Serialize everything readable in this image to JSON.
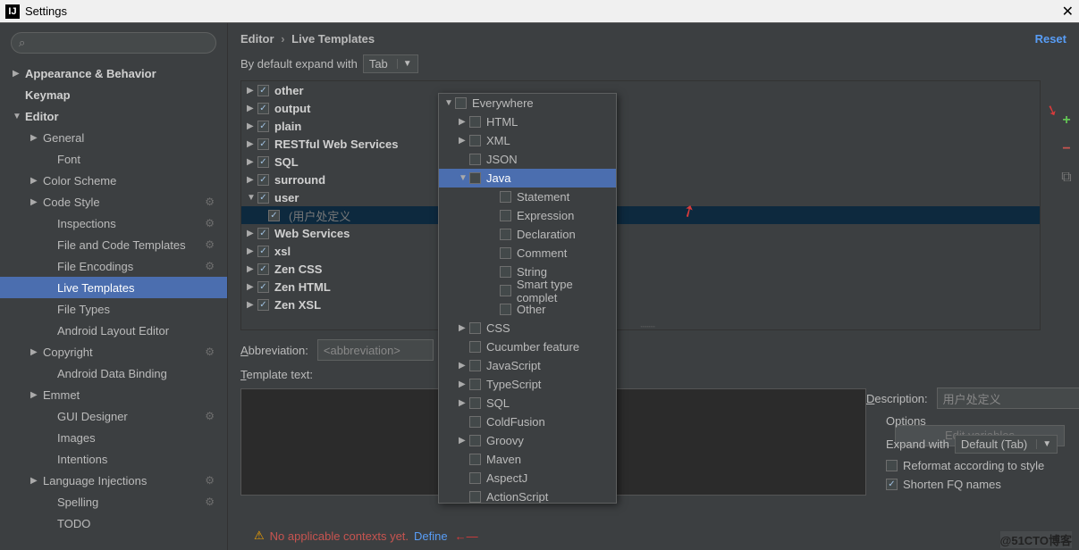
{
  "window": {
    "title": "Settings"
  },
  "header": {
    "breadcrumb_root": "Editor",
    "breadcrumb_leaf": "Live Templates",
    "reset": "Reset"
  },
  "expand": {
    "label": "By default expand with",
    "value": "Tab"
  },
  "sidebar": {
    "items": [
      {
        "label": "Appearance & Behavior",
        "lvl": 0,
        "arrow": "▶",
        "bold": true
      },
      {
        "label": "Keymap",
        "lvl": 0,
        "bold": true
      },
      {
        "label": "Editor",
        "lvl": 0,
        "arrow": "▼",
        "bold": true
      },
      {
        "label": "General",
        "lvl": 1,
        "arrow": "▶"
      },
      {
        "label": "Font",
        "lvl": 2
      },
      {
        "label": "Color Scheme",
        "lvl": 1,
        "arrow": "▶"
      },
      {
        "label": "Code Style",
        "lvl": 1,
        "arrow": "▶",
        "cog": true
      },
      {
        "label": "Inspections",
        "lvl": 2,
        "cog": true
      },
      {
        "label": "File and Code Templates",
        "lvl": 2,
        "cog": true
      },
      {
        "label": "File Encodings",
        "lvl": 2,
        "cog": true
      },
      {
        "label": "Live Templates",
        "lvl": 2,
        "selected": true
      },
      {
        "label": "File Types",
        "lvl": 2
      },
      {
        "label": "Android Layout Editor",
        "lvl": 2
      },
      {
        "label": "Copyright",
        "lvl": 1,
        "arrow": "▶",
        "cog": true
      },
      {
        "label": "Android Data Binding",
        "lvl": 2
      },
      {
        "label": "Emmet",
        "lvl": 1,
        "arrow": "▶"
      },
      {
        "label": "GUI Designer",
        "lvl": 2,
        "cog": true
      },
      {
        "label": "Images",
        "lvl": 2
      },
      {
        "label": "Intentions",
        "lvl": 2
      },
      {
        "label": "Language Injections",
        "lvl": 1,
        "arrow": "▶",
        "cog": true
      },
      {
        "label": "Spelling",
        "lvl": 2,
        "cog": true
      },
      {
        "label": "TODO",
        "lvl": 2
      }
    ]
  },
  "templates": {
    "groups": [
      {
        "name": "other",
        "checked": true
      },
      {
        "name": "output",
        "checked": true
      },
      {
        "name": "plain",
        "checked": true
      },
      {
        "name": "RESTful Web Services",
        "checked": true
      },
      {
        "name": "SQL",
        "checked": true
      },
      {
        "name": "surround",
        "checked": true
      },
      {
        "name": "user",
        "checked": true,
        "expanded": true,
        "children": [
          {
            "abbr": "<abbreviation>",
            "desc": "(用户处定义",
            "selected": true,
            "checked": true
          }
        ]
      },
      {
        "name": "Web Services",
        "checked": true
      },
      {
        "name": "xsl",
        "checked": true
      },
      {
        "name": "Zen CSS",
        "checked": true
      },
      {
        "name": "Zen HTML",
        "checked": true
      },
      {
        "name": "Zen XSL",
        "checked": true
      }
    ]
  },
  "form": {
    "abbr_label": "Abbreviation:",
    "abbr_value": "<abbreviation>",
    "desc_label": "Description:",
    "desc_value": "用户处定义",
    "template_label": "Template text:",
    "edit_vars": "Edit variables"
  },
  "options": {
    "title": "Options",
    "expand_label": "Expand with",
    "expand_value": "Default (Tab)",
    "reformat": "Reformat according to style",
    "shorten": "Shorten FQ names"
  },
  "context": {
    "warn": "No applicable contexts yet.",
    "define": "Define"
  },
  "popup": {
    "items": [
      {
        "label": "Everywhere",
        "lvl": 0,
        "arrow": "▼"
      },
      {
        "label": "HTML",
        "lvl": 1,
        "arrow": "▶"
      },
      {
        "label": "XML",
        "lvl": 1,
        "arrow": "▶"
      },
      {
        "label": "JSON",
        "lvl": 1
      },
      {
        "label": "Java",
        "lvl": 1,
        "arrow": "▼",
        "selected": true
      },
      {
        "label": "Statement",
        "lvl": 2
      },
      {
        "label": "Expression",
        "lvl": 2
      },
      {
        "label": "Declaration",
        "lvl": 2
      },
      {
        "label": "Comment",
        "lvl": 2
      },
      {
        "label": "String",
        "lvl": 2
      },
      {
        "label": "Smart type complet",
        "lvl": 2
      },
      {
        "label": "Other",
        "lvl": 2
      },
      {
        "label": "CSS",
        "lvl": 1,
        "arrow": "▶"
      },
      {
        "label": "Cucumber feature",
        "lvl": 1
      },
      {
        "label": "JavaScript",
        "lvl": 1,
        "arrow": "▶"
      },
      {
        "label": "TypeScript",
        "lvl": 1,
        "arrow": "▶"
      },
      {
        "label": "SQL",
        "lvl": 1,
        "arrow": "▶"
      },
      {
        "label": "ColdFusion",
        "lvl": 1
      },
      {
        "label": "Groovy",
        "lvl": 1,
        "arrow": "▶"
      },
      {
        "label": "Maven",
        "lvl": 1
      },
      {
        "label": "AspectJ",
        "lvl": 1
      },
      {
        "label": "ActionScript",
        "lvl": 1
      }
    ]
  },
  "watermark": "@51CTO博客"
}
